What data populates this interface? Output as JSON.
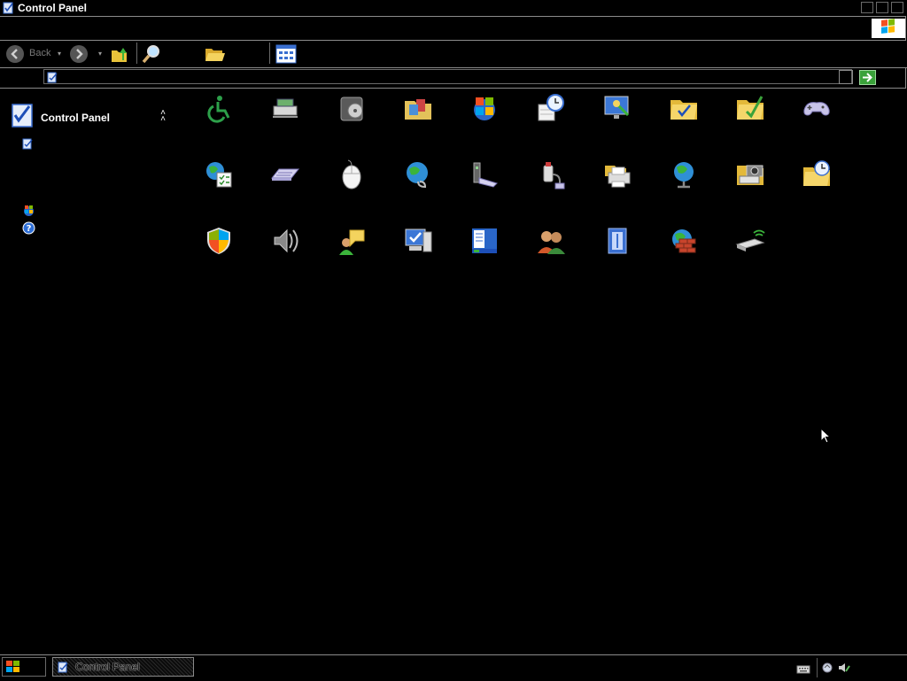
{
  "window": {
    "title": "Control Panel"
  },
  "toolbar": {
    "back_label": "Back",
    "forward_label": "",
    "up_label": "",
    "search_label": "",
    "folders_label": "",
    "views_label": ""
  },
  "address": {
    "value": ""
  },
  "left_pane": {
    "header": "Control Panel"
  },
  "icons": [
    "accessibility-icon",
    "add-hardware-icon",
    "add-remove-programs-icon",
    "administrative-tools-icon",
    "automatic-updates-icon",
    "date-time-icon",
    "display-icon",
    "folder-options-icon",
    "fonts-folder-icon",
    "game-controllers-icon",
    "internet-options-icon",
    "keyboard-icon",
    "mouse-icon",
    "network-connections-icon",
    "phone-modem-icon",
    "power-options-icon",
    "printers-faxes-icon",
    "regional-options-icon",
    "scanners-cameras-icon",
    "scheduled-tasks-icon",
    "security-center-icon",
    "sounds-icon",
    "speech-icon",
    "system-icon",
    "taskbar-start-menu-icon",
    "user-accounts-icon",
    "windows-cardspace-icon",
    "windows-firewall-icon",
    "wireless-network-setup-icon"
  ],
  "taskbar": {
    "task_label": "Control Panel"
  },
  "colors": {
    "background": "#000000",
    "go": "#3aa23a",
    "border": "#8a8a8a"
  }
}
